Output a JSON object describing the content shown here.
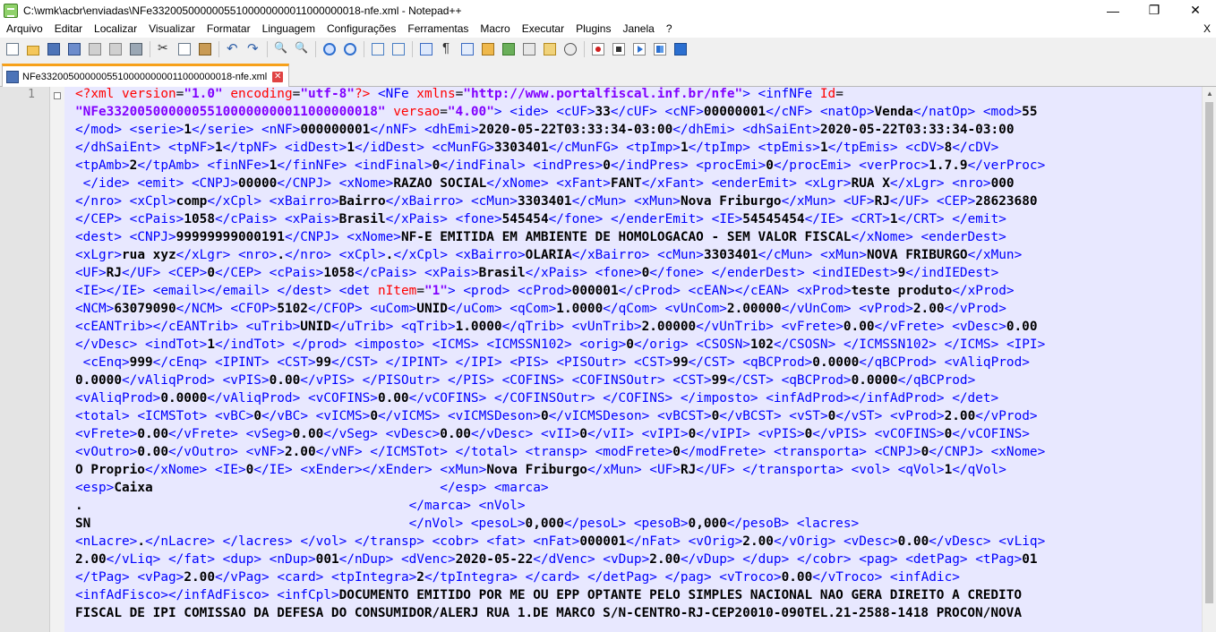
{
  "window": {
    "title": "C:\\wmk\\acbr\\enviadas\\NFe33200500000055100000000011000000018-nfe.xml - Notepad++",
    "minimize_glyph": "—",
    "maximize_glyph": "❐",
    "close_glyph": "✕"
  },
  "menu": {
    "items": [
      "Arquivo",
      "Editar",
      "Localizar",
      "Visualizar",
      "Formatar",
      "Linguagem",
      "Configurações",
      "Ferramentas",
      "Macro",
      "Executar",
      "Plugins",
      "Janela",
      "?"
    ],
    "close_glyph": "X"
  },
  "toolbar": {
    "icons": [
      "new-file-icon",
      "open-file-icon",
      "save-icon",
      "save-all-icon",
      "close-icon",
      "close-all-icon",
      "print-icon",
      "cut-icon",
      "copy-icon",
      "paste-icon",
      "undo-icon",
      "redo-icon",
      "find-icon",
      "replace-icon",
      "zoom-in-icon",
      "zoom-out-icon",
      "sync-vertical-icon",
      "sync-horizontal-icon",
      "word-wrap-icon",
      "show-all-chars-icon",
      "indent-guide-icon",
      "user-language-icon",
      "document-map-icon",
      "function-list-icon",
      "folder-workspace-icon",
      "monitoring-icon",
      "record-macro-icon",
      "stop-macro-icon",
      "playback-macro-icon",
      "run-macro-multiple-icon",
      "save-macro-icon"
    ]
  },
  "tab": {
    "label": "NFe33200500000055100000000011000000018-nfe.xml",
    "close_glyph": "✕"
  },
  "editor": {
    "line_number": "1",
    "code_lines": [
      "<?xml version=\"1.0\" encoding=\"utf-8\"?> <NFe xmlns=\"http://www.portalfiscal.inf.br/nfe\"> <infNFe Id=",
      "\"NFe33200500000055100000000011000000018\" versao=\"4.00\"> <ide> <cUF>33</cUF> <cNF>00000001</cNF> <natOp>Venda</natOp> <mod>55",
      "</mod> <serie>1</serie> <nNF>000000001</nNF> <dhEmi>2020-05-22T03:33:34-03:00</dhEmi> <dhSaiEnt>2020-05-22T03:33:34-03:00",
      "</dhSaiEnt> <tpNF>1</tpNF> <idDest>1</idDest> <cMunFG>3303401</cMunFG> <tpImp>1</tpImp> <tpEmis>1</tpEmis> <cDV>8</cDV>",
      "<tpAmb>2</tpAmb> <finNFe>1</finNFe> <indFinal>0</indFinal> <indPres>0</indPres> <procEmi>0</procEmi> <verProc>1.7.9</verProc>",
      " </ide> <emit> <CNPJ>00000</CNPJ> <xNome>RAZAO SOCIAL</xNome> <xFant>FANT</xFant> <enderEmit> <xLgr>RUA X</xLgr> <nro>000",
      "</nro> <xCpl>comp</xCpl> <xBairro>Bairro</xBairro> <cMun>3303401</cMun> <xMun>Nova Friburgo</xMun> <UF>RJ</UF> <CEP>28623680",
      "</CEP> <cPais>1058</cPais> <xPais>Brasil</xPais> <fone>545454</fone> </enderEmit> <IE>54545454</IE> <CRT>1</CRT> </emit>",
      "<dest> <CNPJ>99999999000191</CNPJ> <xNome>NF-E EMITIDA EM AMBIENTE DE HOMOLOGACAO - SEM VALOR FISCAL</xNome> <enderDest>",
      "<xLgr>rua xyz</xLgr> <nro>.</nro> <xCpl>.</xCpl> <xBairro>OLARIA</xBairro> <cMun>3303401</cMun> <xMun>NOVA FRIBURGO</xMun>",
      "<UF>RJ</UF> <CEP>0</CEP> <cPais>1058</cPais> <xPais>Brasil</xPais> <fone>0</fone> </enderDest> <indIEDest>9</indIEDest>",
      "<IE></IE> <email></email> </dest> <det nItem=\"1\"> <prod> <cProd>000001</cProd> <cEAN></cEAN> <xProd>teste produto</xProd>",
      "<NCM>63079090</NCM> <CFOP>5102</CFOP> <uCom>UNID</uCom> <qCom>1.0000</qCom> <vUnCom>2.00000</vUnCom> <vProd>2.00</vProd>",
      "<cEANTrib></cEANTrib> <uTrib>UNID</uTrib> <qTrib>1.0000</qTrib> <vUnTrib>2.00000</vUnTrib> <vFrete>0.00</vFrete> <vDesc>0.00",
      "</vDesc> <indTot>1</indTot> </prod> <imposto> <ICMS> <ICMSSN102> <orig>0</orig> <CSOSN>102</CSOSN> </ICMSSN102> </ICMS> <IPI>",
      " <cEnq>999</cEnq> <IPINT> <CST>99</CST> </IPINT> </IPI> <PIS> <PISOutr> <CST>99</CST> <qBCProd>0.0000</qBCProd> <vAliqProd>",
      "0.0000</vAliqProd> <vPIS>0.00</vPIS> </PISOutr> </PIS> <COFINS> <COFINSOutr> <CST>99</CST> <qBCProd>0.0000</qBCProd>",
      "<vAliqProd>0.0000</vAliqProd> <vCOFINS>0.00</vCOFINS> </COFINSOutr> </COFINS> </imposto> <infAdProd></infAdProd> </det>",
      "<total> <ICMSTot> <vBC>0</vBC> <vICMS>0</vICMS> <vICMSDeson>0</vICMSDeson> <vBCST>0</vBCST> <vST>0</vST> <vProd>2.00</vProd>",
      "<vFrete>0.00</vFrete> <vSeg>0.00</vSeg> <vDesc>0.00</vDesc> <vII>0</vII> <vIPI>0</vIPI> <vPIS>0</vPIS> <vCOFINS>0</vCOFINS>",
      "<vOutro>0.00</vOutro> <vNF>2.00</vNF> </ICMSTot> </total> <transp> <modFrete>0</modFrete> <transporta> <CNPJ>0</CNPJ> <xNome>",
      "O Proprio</xNome> <IE>0</IE> <xEnder></xEnder> <xMun>Nova Friburgo</xMun> <UF>RJ</UF> </transporta> <vol> <qVol>1</qVol>",
      "<esp>Caixa                                     </esp> <marca>",
      ".                                          </marca> <nVol>",
      "SN                                         </nVol> <pesoL>0,000</pesoL> <pesoB>0,000</pesoB> <lacres>",
      "<nLacre>.</nLacre> </lacres> </vol> </transp> <cobr> <fat> <nFat>000001</nFat> <vOrig>2.00</vOrig> <vDesc>0.00</vDesc> <vLiq>",
      "2.00</vLiq> </fat> <dup> <nDup>001</nDup> <dVenc>2020-05-22</dVenc> <vDup>2.00</vDup> </dup> </cobr> <pag> <detPag> <tPag>01",
      "</tPag> <vPag>2.00</vPag> <card> <tpIntegra>2</tpIntegra> </card> </detPag> </pag> <vTroco>0.00</vTroco> <infAdic>",
      "<infAdFisco></infAdFisco> <infCpl>DOCUMENTO EMITIDO POR ME OU EPP OPTANTE PELO SIMPLES NACIONAL NAO GERA DIREITO A CREDITO",
      "FISCAL DE IPI COMISSAO DA DEFESA DO CONSUMIDOR/ALERJ RUA 1.DE MARCO S/N-CENTRO-RJ-CEP20010-090TEL.21-2588-1418 PROCON/NOVA"
    ]
  },
  "colors": {
    "tag": "#0000ff",
    "attribute": "#ff0000",
    "attribute_value": "#8000ff",
    "text": "#000000",
    "code_background": "#e8e8ff",
    "active_tab_accent": "#f7a11a"
  }
}
